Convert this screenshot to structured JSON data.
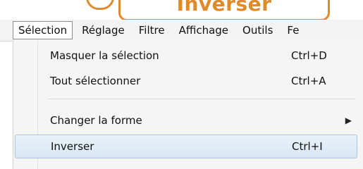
{
  "callout": {
    "text": "Inverser",
    "color": "#e08a2a"
  },
  "menubar": {
    "items": [
      {
        "label": "Sélection",
        "active": true
      },
      {
        "label": "Réglage"
      },
      {
        "label": "Filtre"
      },
      {
        "label": "Affichage"
      },
      {
        "label": "Outils"
      },
      {
        "label": "Fe"
      }
    ]
  },
  "dropdown": {
    "items": [
      {
        "label": "Masquer la sélection",
        "shortcut": "Ctrl+D"
      },
      {
        "label": "Tout sélectionner",
        "shortcut": "Ctrl+A"
      },
      {
        "label": "Changer la forme",
        "submenu_icon": "chevron-right-icon"
      },
      {
        "label": "Inverser",
        "shortcut": "Ctrl+I",
        "highlighted": true
      }
    ]
  }
}
